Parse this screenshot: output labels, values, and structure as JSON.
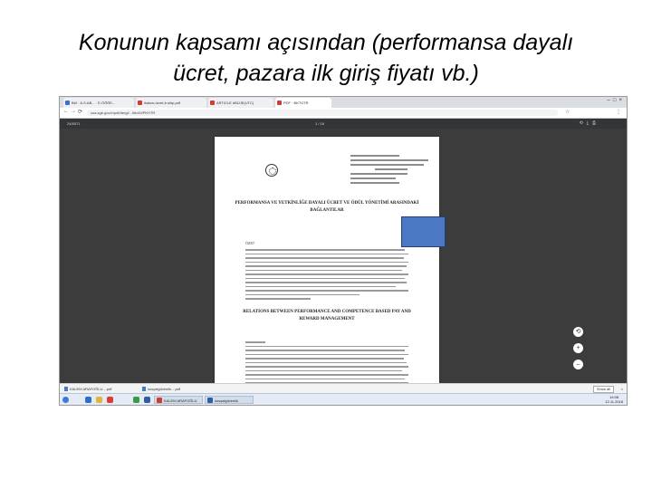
{
  "slide": {
    "title_line1": "Konunun kapsamı açısından (performansa dayalı",
    "title_line2": "ücret, pazara  ilk giriş fiyatı vb.)"
  },
  "browser": {
    "tabs": [
      {
        "label": "B#I · A.S.AB... · E-ÖĞRE...",
        "color": "#3b6fd1"
      },
      {
        "label": "ikaluw-ücret-b.slirp.pdf",
        "color": "#d33b2e"
      },
      {
        "label": "ARTICLE #BÜJE(UTC)",
        "color": "#d33b2e"
      },
      {
        "label": "PDF · BKTÜTR",
        "color": "#d33b2e"
      }
    ],
    "url": "cua.sgb.gov.tr/pdf/dergi/...file/49/PKHTR",
    "pdf_toolbar": {
      "filename": "24/5071",
      "page_indicator": "1 / 16"
    }
  },
  "document": {
    "heading_1": "PERFORMANSA VE YETKİNLİĞE DAYALI ÜCRET VE ÖDÜL YÖNETİMİ ARASINDAKİ BAĞLANTILAR",
    "heading_2": "RELATIONS BETWEEN PERFORMANCE AND COMPETENCE BASED PAY AND REWARD MANAGEMENT",
    "abstract_label": "ÖZET"
  },
  "side_buttons": [
    "⟲",
    "+",
    "–"
  ],
  "downloads": {
    "items": [
      "KALEM ARAFOĞLU....pdf",
      "sosyalgüvenlik....pdf"
    ],
    "show_all": "Show all"
  },
  "taskbar": {
    "apps": [
      "KALEM ARAFOĞLU",
      "sosyalgüvenlik"
    ],
    "time": "14:08",
    "date": "12.11.2018"
  },
  "colors": {
    "blue_box": "#4a78c2",
    "pdf_viewer_bg": "#3c3c3c"
  }
}
